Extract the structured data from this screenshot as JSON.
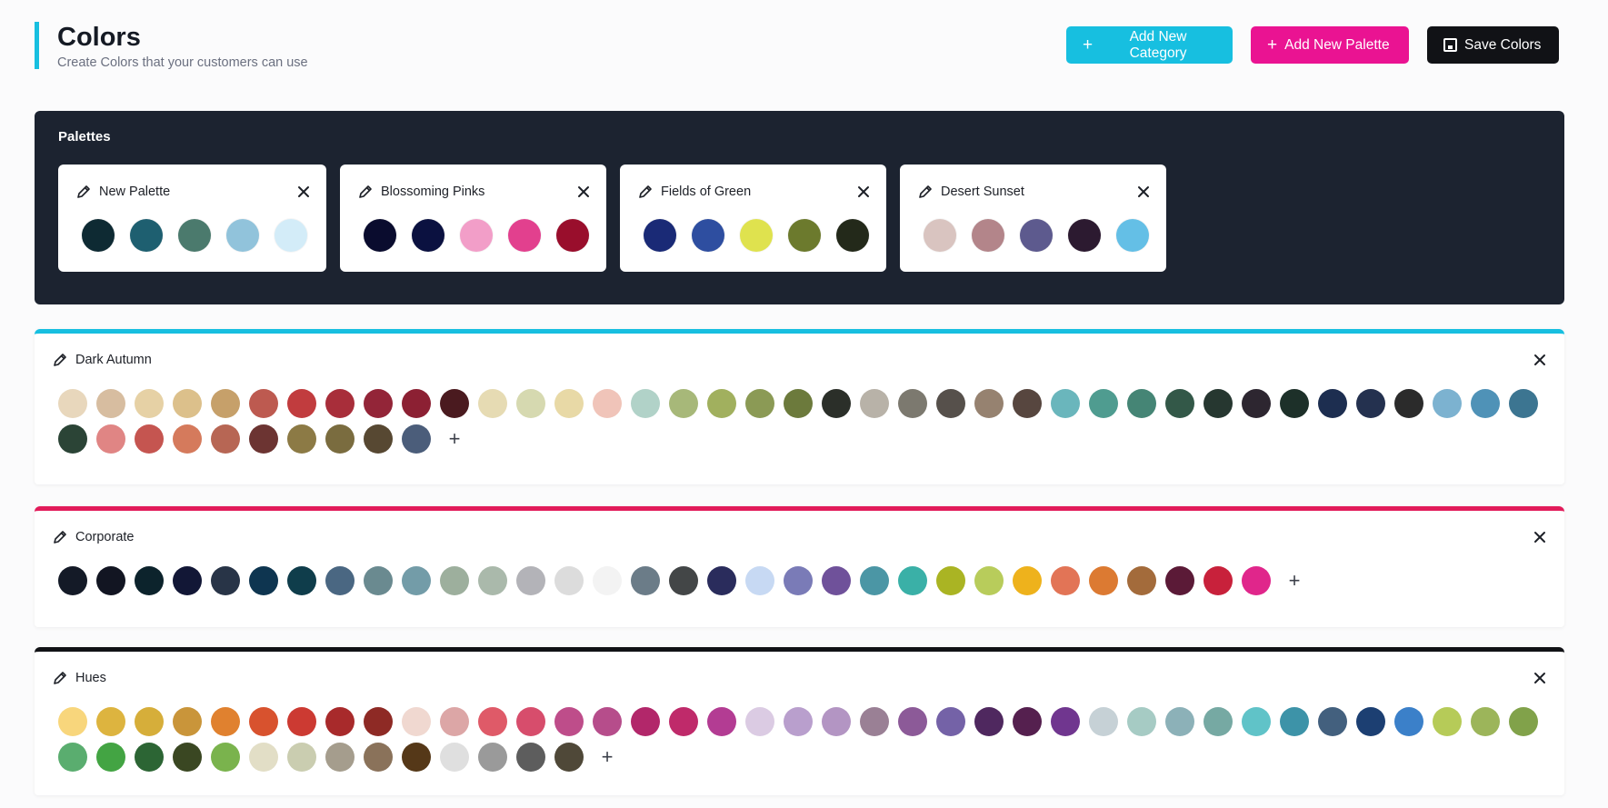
{
  "header": {
    "title": "Colors",
    "subtitle": "Create Colors that your customers can use"
  },
  "toolbar": {
    "add_category_label": "Add New Category",
    "add_palette_label": "Add New Palette",
    "save_label": "Save Colors"
  },
  "palettes": {
    "title": "Palettes",
    "items": [
      {
        "name": "New Palette",
        "colors": [
          "#0e2a33",
          "#1e5f70",
          "#4b7a6d",
          "#91c3db",
          "#d3ecf8"
        ]
      },
      {
        "name": "Blossoming Pinks",
        "colors": [
          "#0a0c2e",
          "#0b1140",
          "#f29ec8",
          "#e2408e",
          "#990e2c"
        ]
      },
      {
        "name": "Fields of Green",
        "colors": [
          "#1a2a76",
          "#2e4ea0",
          "#dfe24e",
          "#6c7a2d",
          "#23291a"
        ]
      },
      {
        "name": "Desert Sunset",
        "colors": [
          "#d9c4c0",
          "#b3858a",
          "#5d5a8e",
          "#2c1a30",
          "#64bfe6"
        ]
      }
    ]
  },
  "categories": [
    {
      "name": "Dark Autumn",
      "accent": "#17bfe0",
      "colors": [
        "#e8d7bc",
        "#d7bda0",
        "#e6d1a5",
        "#dcc08b",
        "#c6a06a",
        "#bd5a50",
        "#c13c3e",
        "#a82e3a",
        "#932538",
        "#8c2033",
        "#4a1a1f",
        "#e6dbb3",
        "#d6d9b0",
        "#e8d9a6",
        "#f0c4b9",
        "#b1d2c8",
        "#a7b879",
        "#a1b05e",
        "#8b9a55",
        "#6c7a3c",
        "#2b2f29",
        "#b8b2a8",
        "#7c796f",
        "#56504b",
        "#968270",
        "#57463f",
        "#6ab6bc",
        "#4f9c90",
        "#458575",
        "#335848",
        "#263730",
        "#2d2630",
        "#1d3029",
        "#1d2e50",
        "#24314f",
        "#2b2b2b",
        "#7cb2d0",
        "#4f92b7",
        "#3c7591",
        "#2b4436",
        "#e08584",
        "#c55550",
        "#d57a5c",
        "#b76654",
        "#6c3432",
        "#8c7a45",
        "#7a6c3f",
        "#574832",
        "#4b5d7a"
      ]
    },
    {
      "name": "Corporate",
      "accent": "#e21b5a",
      "colors": [
        "#141a27",
        "#121522",
        "#0c232c",
        "#121736",
        "#283447",
        "#0e3550",
        "#0f3d4b",
        "#4a6782",
        "#6a8a90",
        "#739ca8",
        "#9daf9d",
        "#aab9ab",
        "#b3b3b8",
        "#dcdcdc",
        "#f3f3f3",
        "#6b7c88",
        "#434647",
        "#2a2c5c",
        "#c7d9f3",
        "#7a7bb7",
        "#6f519a",
        "#4b96a5",
        "#3ab0a7",
        "#aab423",
        "#b8cc5b",
        "#eeb21c",
        "#e27456",
        "#dc7a32",
        "#a36b3b",
        "#5b1a37",
        "#c8213b",
        "#e0268b"
      ]
    },
    {
      "name": "Hues",
      "accent": "#111216",
      "colors": [
        "#f8d67c",
        "#ddb43f",
        "#d6ae3a",
        "#c9953a",
        "#e0812f",
        "#d8522e",
        "#cc3a32",
        "#a82a2b",
        "#8e2a25",
        "#f0d8d0",
        "#dca6a6",
        "#df5a68",
        "#d74d6c",
        "#be4d8a",
        "#b64d8b",
        "#b2276a",
        "#bf2a6a",
        "#b33c93",
        "#dbcbe3",
        "#b99fcd",
        "#b395c3",
        "#9a8095",
        "#8c5a98",
        "#7462a7",
        "#4f285f",
        "#55204f",
        "#70368f",
        "#c6d1d6",
        "#a6cbc4",
        "#8cb1b8",
        "#76a9a3",
        "#60c3c8",
        "#3d93a8",
        "#43607e",
        "#1c3f72",
        "#3b80c9",
        "#b6cb58",
        "#9cb55a",
        "#81a24a",
        "#5aad6f",
        "#43a443",
        "#2c6534",
        "#3a4722",
        "#7ab34d",
        "#e2dec6",
        "#cacdb0",
        "#a59d8d",
        "#8a725a",
        "#553818",
        "#dfdfdf",
        "#9a9a9a",
        "#5d5d5d",
        "#4f4838"
      ]
    }
  ]
}
